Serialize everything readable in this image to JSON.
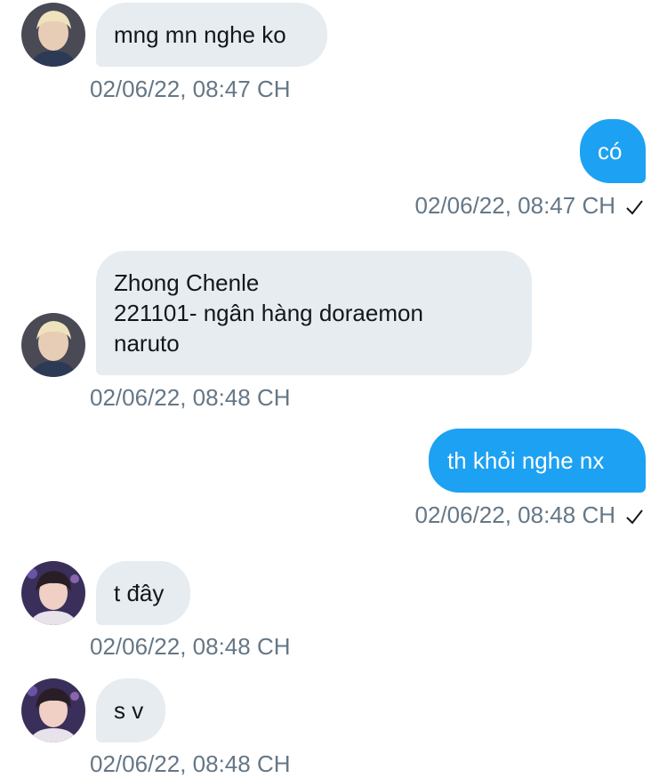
{
  "messages": [
    {
      "side": "in",
      "avatar": "avatar-1",
      "lines": [
        "mng mn nghe ko"
      ],
      "time": "02/06/22, 08:47 CH"
    },
    {
      "side": "out",
      "lines": [
        "có"
      ],
      "time": "02/06/22, 08:47 CH",
      "status_icon": "checkmark-icon"
    },
    {
      "side": "in",
      "avatar": "avatar-1",
      "lines": [
        "Zhong Chenle",
        "221101- ngân hàng doraemon",
        "naruto"
      ],
      "time": "02/06/22, 08:48 CH"
    },
    {
      "side": "out",
      "lines": [
        "th khỏi nghe nx"
      ],
      "time": "02/06/22, 08:48 CH",
      "status_icon": "checkmark-icon"
    },
    {
      "side": "in",
      "avatar": "avatar-2",
      "lines": [
        "t đây"
      ],
      "time": "02/06/22, 08:48 CH"
    },
    {
      "side": "in",
      "avatar": "avatar-2",
      "lines": [
        "s v"
      ],
      "time": "02/06/22, 08:48 CH"
    }
  ],
  "colors": {
    "incoming_bubble": "#e6ecf0",
    "outgoing_bubble": "#1da1f2",
    "timestamp": "#657786",
    "text": "#14171a"
  }
}
